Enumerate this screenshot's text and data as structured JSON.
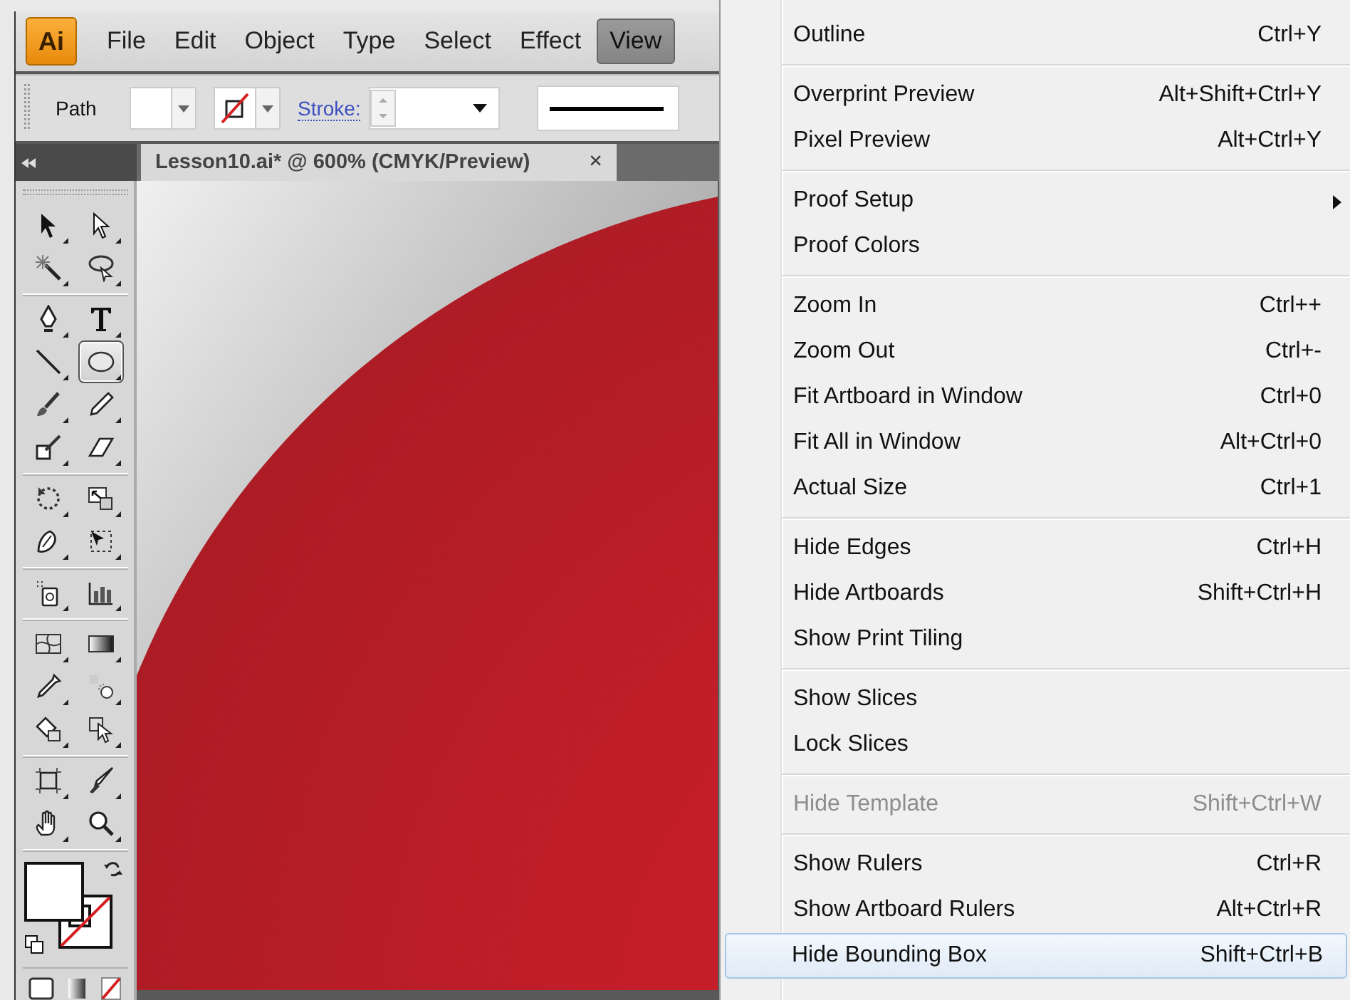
{
  "menu_bar": {
    "logo": "Ai",
    "items": [
      {
        "label": "File",
        "selected": false
      },
      {
        "label": "Edit",
        "selected": false
      },
      {
        "label": "Object",
        "selected": false
      },
      {
        "label": "Type",
        "selected": false
      },
      {
        "label": "Select",
        "selected": false
      },
      {
        "label": "Effect",
        "selected": false
      },
      {
        "label": "View",
        "selected": true
      }
    ]
  },
  "control_bar": {
    "selection_label": "Path",
    "stroke_label": "Stroke:"
  },
  "document_tab": {
    "title": "Lesson10.ai* @ 600% (CMYK/Preview)",
    "close": "×"
  },
  "tool_groups": [
    {
      "tools": [
        {
          "kind": "selection",
          "selected": false
        },
        {
          "kind": "direct-selection",
          "selected": false
        },
        {
          "kind": "magic-wand",
          "selected": false
        },
        {
          "kind": "lasso",
          "selected": false
        }
      ]
    },
    {
      "tools": [
        {
          "kind": "pen",
          "selected": false
        },
        {
          "kind": "type",
          "selected": false
        },
        {
          "kind": "line",
          "selected": false
        },
        {
          "kind": "ellipse",
          "selected": true
        },
        {
          "kind": "paintbrush",
          "selected": false
        },
        {
          "kind": "pencil",
          "selected": false
        },
        {
          "kind": "blob-brush",
          "selected": false
        },
        {
          "kind": "eraser",
          "selected": false
        }
      ]
    },
    {
      "tools": [
        {
          "kind": "rotate",
          "selected": false
        },
        {
          "kind": "scale",
          "selected": false
        },
        {
          "kind": "warp",
          "selected": false
        },
        {
          "kind": "free-transform",
          "selected": false
        }
      ]
    },
    {
      "tools": [
        {
          "kind": "symbol-sprayer",
          "selected": false
        },
        {
          "kind": "graph",
          "selected": false
        }
      ]
    },
    {
      "tools": [
        {
          "kind": "mesh",
          "selected": false
        },
        {
          "kind": "gradient",
          "selected": false
        },
        {
          "kind": "eyedropper",
          "selected": false
        },
        {
          "kind": "blend",
          "selected": false
        },
        {
          "kind": "paint-bucket",
          "selected": false
        },
        {
          "kind": "paint-selection",
          "selected": false
        }
      ]
    },
    {
      "tools": [
        {
          "kind": "artboard",
          "selected": false
        },
        {
          "kind": "slice",
          "selected": false
        },
        {
          "kind": "hand",
          "selected": false
        },
        {
          "kind": "zoom",
          "selected": false
        }
      ]
    }
  ],
  "view_menu": {
    "groups": [
      {
        "items": [
          {
            "label": "Outline",
            "shortcut": "Ctrl+Y",
            "has_submenu": false,
            "disabled": false,
            "selected": false
          }
        ]
      },
      {
        "items": [
          {
            "label": "Overprint Preview",
            "shortcut": "Alt+Shift+Ctrl+Y",
            "has_submenu": false,
            "disabled": false,
            "selected": false
          },
          {
            "label": "Pixel Preview",
            "shortcut": "Alt+Ctrl+Y",
            "has_submenu": false,
            "disabled": false,
            "selected": false
          }
        ]
      },
      {
        "items": [
          {
            "label": "Proof Setup",
            "has_submenu": true,
            "disabled": false,
            "selected": false
          },
          {
            "label": "Proof Colors",
            "has_submenu": false,
            "disabled": false,
            "selected": false
          }
        ]
      },
      {
        "items": [
          {
            "label": "Zoom In",
            "shortcut": "Ctrl++",
            "has_submenu": false,
            "disabled": false,
            "selected": false
          },
          {
            "label": "Zoom Out",
            "shortcut": "Ctrl+-",
            "has_submenu": false,
            "disabled": false,
            "selected": false
          },
          {
            "label": "Fit Artboard in Window",
            "shortcut": "Ctrl+0",
            "has_submenu": false,
            "disabled": false,
            "selected": false
          },
          {
            "label": "Fit All in Window",
            "shortcut": "Alt+Ctrl+0",
            "has_submenu": false,
            "disabled": false,
            "selected": false
          },
          {
            "label": "Actual Size",
            "shortcut": "Ctrl+1",
            "has_submenu": false,
            "disabled": false,
            "selected": false
          }
        ]
      },
      {
        "items": [
          {
            "label": "Hide Edges",
            "shortcut": "Ctrl+H",
            "has_submenu": false,
            "disabled": false,
            "selected": false
          },
          {
            "label": "Hide Artboards",
            "shortcut": "Shift+Ctrl+H",
            "has_submenu": false,
            "disabled": false,
            "selected": false
          },
          {
            "label": "Show Print Tiling",
            "has_submenu": false,
            "disabled": false,
            "selected": false
          }
        ]
      },
      {
        "items": [
          {
            "label": "Show Slices",
            "has_submenu": false,
            "disabled": false,
            "selected": false
          },
          {
            "label": "Lock Slices",
            "has_submenu": false,
            "disabled": false,
            "selected": false
          }
        ]
      },
      {
        "items": [
          {
            "label": "Hide Template",
            "shortcut": "Shift+Ctrl+W",
            "has_submenu": false,
            "disabled": true,
            "selected": false
          }
        ]
      },
      {
        "items": [
          {
            "label": "Show Rulers",
            "shortcut": "Ctrl+R",
            "has_submenu": false,
            "disabled": false,
            "selected": false
          },
          {
            "label": "Show Artboard Rulers",
            "shortcut": "Alt+Ctrl+R",
            "has_submenu": false,
            "disabled": false,
            "selected": false
          },
          {
            "label": "Hide Bounding Box",
            "shortcut": "Shift+Ctrl+B",
            "has_submenu": false,
            "disabled": false,
            "selected": true
          }
        ]
      }
    ]
  }
}
